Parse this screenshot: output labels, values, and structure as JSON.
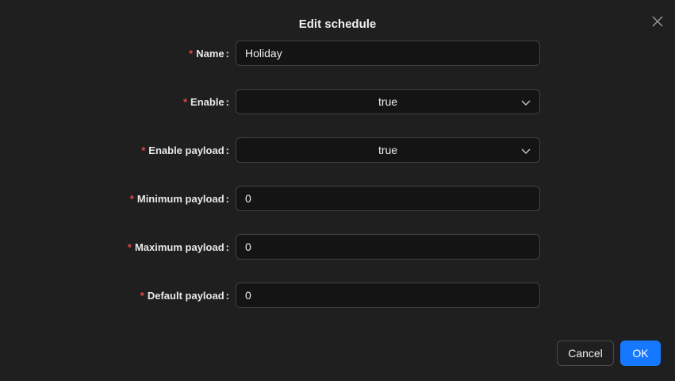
{
  "dialog": {
    "title": "Edit schedule"
  },
  "fields": [
    {
      "required_mark": "*",
      "label": "Name",
      "colon": ":",
      "value": "Holiday",
      "kind": "input"
    },
    {
      "required_mark": "*",
      "label": "Enable",
      "colon": ":",
      "value": "true",
      "kind": "select"
    },
    {
      "required_mark": "*",
      "label": "Enable payload",
      "colon": ":",
      "value": "true",
      "kind": "select"
    },
    {
      "required_mark": "*",
      "label": "Minimum payload",
      "colon": ":",
      "value": "0",
      "kind": "input"
    },
    {
      "required_mark": "*",
      "label": "Maximum payload",
      "colon": ":",
      "value": "0",
      "kind": "input"
    },
    {
      "required_mark": "*",
      "label": "Default payload",
      "colon": ":",
      "value": "0",
      "kind": "input"
    }
  ],
  "footer": {
    "cancel_label": "Cancel",
    "ok_label": "OK"
  },
  "icons": {
    "close": "close-icon",
    "select_arrow": "chevron-down-icon"
  },
  "colors": {
    "primary": "#1677ff",
    "required": "#e04848",
    "background": "#1f1f1f",
    "field_bg": "#141414"
  }
}
